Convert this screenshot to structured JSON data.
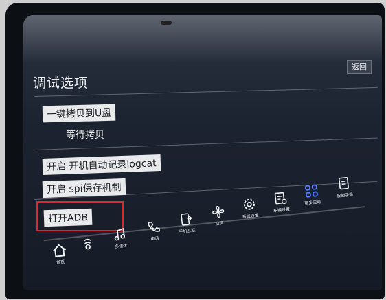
{
  "header": {
    "title": "调试选项",
    "back_label": "返回"
  },
  "options": {
    "copy_button": "一键拷贝到U盘",
    "copy_status": "等待拷贝",
    "logcat_button": "开启 开机自动记录logcat",
    "spi_button": "开启 spi保存机制",
    "adb_button": "打开ADB"
  },
  "nav": {
    "items": [
      {
        "label": "首页",
        "icon": "home-icon"
      },
      {
        "label": "",
        "icon": "phone-mirror-icon"
      },
      {
        "label": "多媒体",
        "icon": "music-icon"
      },
      {
        "label": "电话",
        "icon": "phone-icon"
      },
      {
        "label": "手机互联",
        "icon": "phone-link-icon"
      },
      {
        "label": "空调",
        "icon": "fan-icon"
      },
      {
        "label": "系统设置",
        "icon": "gear-icon"
      },
      {
        "label": "车辆设置",
        "icon": "car-settings-icon"
      },
      {
        "label": "更多应用",
        "icon": "apps-icon"
      },
      {
        "label": "智能手册",
        "icon": "manual-icon"
      }
    ]
  },
  "colors": {
    "highlight": "#e3262b",
    "apps_accent": "#5a7dff"
  }
}
